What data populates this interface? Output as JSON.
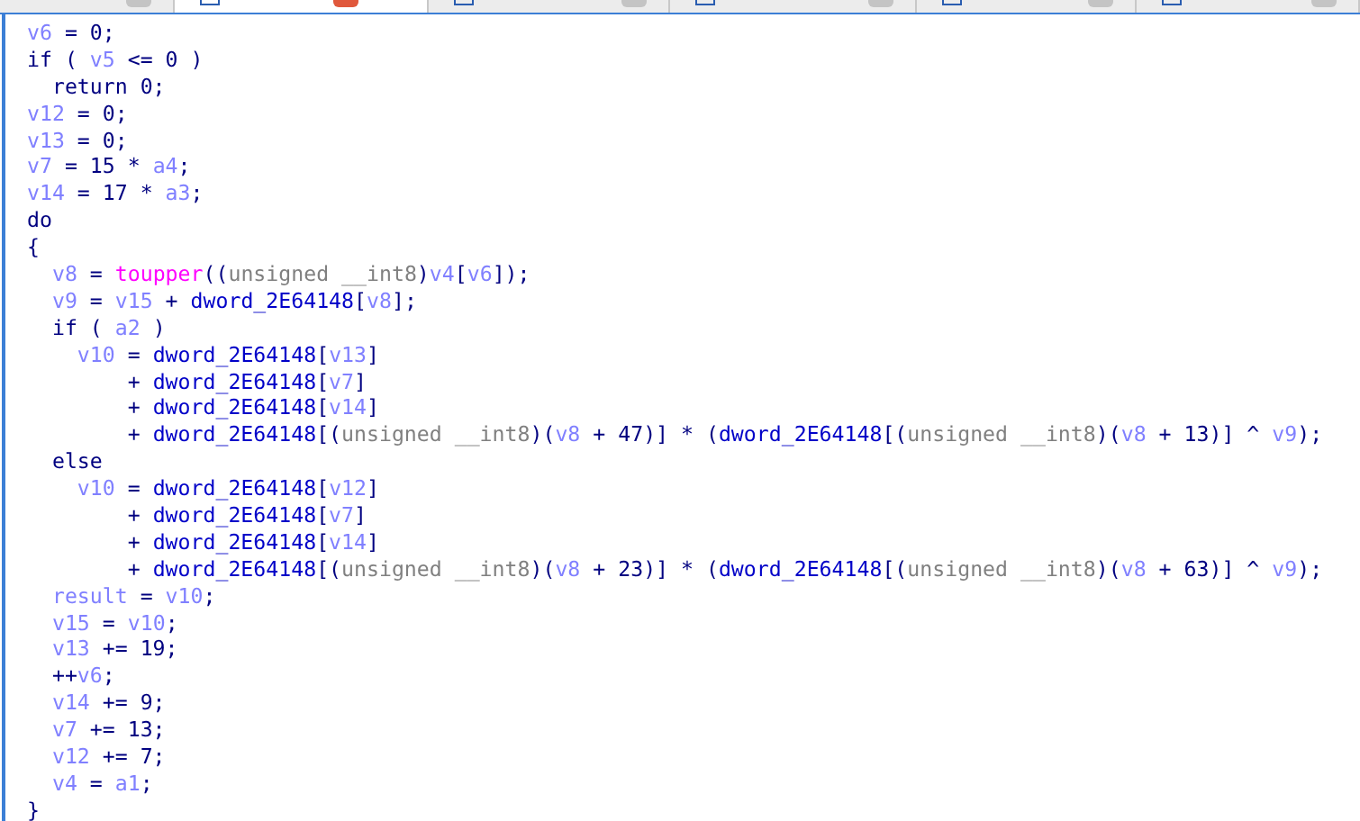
{
  "tabs": [
    {
      "selected": false
    },
    {
      "selected": true
    },
    {
      "selected": false
    },
    {
      "selected": false
    },
    {
      "selected": false
    },
    {
      "selected": false
    }
  ],
  "code_lines": [
    [
      {
        "kind": "var",
        "text": "v6"
      },
      {
        "kind": "plain",
        "text": " = 0;"
      }
    ],
    [
      {
        "kind": "plain",
        "text": "if ( "
      },
      {
        "kind": "var",
        "text": "v5"
      },
      {
        "kind": "plain",
        "text": " <= 0 )"
      }
    ],
    [
      {
        "kind": "plain",
        "text": "  return 0;"
      }
    ],
    [
      {
        "kind": "var",
        "text": "v12"
      },
      {
        "kind": "plain",
        "text": " = 0;"
      }
    ],
    [
      {
        "kind": "var",
        "text": "v13"
      },
      {
        "kind": "plain",
        "text": " = 0;"
      }
    ],
    [
      {
        "kind": "var",
        "text": "v7"
      },
      {
        "kind": "plain",
        "text": " = 15 * "
      },
      {
        "kind": "var",
        "text": "a4"
      },
      {
        "kind": "plain",
        "text": ";"
      }
    ],
    [
      {
        "kind": "var",
        "text": "v14"
      },
      {
        "kind": "plain",
        "text": " = 17 * "
      },
      {
        "kind": "var",
        "text": "a3"
      },
      {
        "kind": "plain",
        "text": ";"
      }
    ],
    [
      {
        "kind": "plain",
        "text": "do"
      }
    ],
    [
      {
        "kind": "plain",
        "text": "{"
      }
    ],
    [
      {
        "kind": "var",
        "text": "  v8"
      },
      {
        "kind": "plain",
        "text": " = "
      },
      {
        "kind": "func",
        "text": "toupper"
      },
      {
        "kind": "plain",
        "text": "(("
      },
      {
        "kind": "type",
        "text": "unsigned __int8"
      },
      {
        "kind": "plain",
        "text": ")"
      },
      {
        "kind": "var",
        "text": "v4"
      },
      {
        "kind": "plain",
        "text": "["
      },
      {
        "kind": "var",
        "text": "v6"
      },
      {
        "kind": "plain",
        "text": "]);"
      }
    ],
    [
      {
        "kind": "var",
        "text": "  v9"
      },
      {
        "kind": "plain",
        "text": " = "
      },
      {
        "kind": "var",
        "text": "v15"
      },
      {
        "kind": "plain",
        "text": " + "
      },
      {
        "kind": "global",
        "text": "dword_2E64148"
      },
      {
        "kind": "plain",
        "text": "["
      },
      {
        "kind": "var",
        "text": "v8"
      },
      {
        "kind": "plain",
        "text": "];"
      }
    ],
    [
      {
        "kind": "plain",
        "text": "  if ( "
      },
      {
        "kind": "var",
        "text": "a2"
      },
      {
        "kind": "plain",
        "text": " )"
      }
    ],
    [
      {
        "kind": "var",
        "text": "    v10"
      },
      {
        "kind": "plain",
        "text": " = "
      },
      {
        "kind": "global",
        "text": "dword_2E64148"
      },
      {
        "kind": "plain",
        "text": "["
      },
      {
        "kind": "var",
        "text": "v13"
      },
      {
        "kind": "plain",
        "text": "]"
      }
    ],
    [
      {
        "kind": "plain",
        "text": "        + "
      },
      {
        "kind": "global",
        "text": "dword_2E64148"
      },
      {
        "kind": "plain",
        "text": "["
      },
      {
        "kind": "var",
        "text": "v7"
      },
      {
        "kind": "plain",
        "text": "]"
      }
    ],
    [
      {
        "kind": "plain",
        "text": "        + "
      },
      {
        "kind": "global",
        "text": "dword_2E64148"
      },
      {
        "kind": "plain",
        "text": "["
      },
      {
        "kind": "var",
        "text": "v14"
      },
      {
        "kind": "plain",
        "text": "]"
      }
    ],
    [
      {
        "kind": "plain",
        "text": "        + "
      },
      {
        "kind": "global",
        "text": "dword_2E64148"
      },
      {
        "kind": "plain",
        "text": "[("
      },
      {
        "kind": "type",
        "text": "unsigned __int8"
      },
      {
        "kind": "plain",
        "text": ")("
      },
      {
        "kind": "var",
        "text": "v8"
      },
      {
        "kind": "plain",
        "text": " + 47)] * ("
      },
      {
        "kind": "global",
        "text": "dword_2E64148"
      },
      {
        "kind": "plain",
        "text": "[("
      },
      {
        "kind": "type",
        "text": "unsigned __int8"
      },
      {
        "kind": "plain",
        "text": ")("
      },
      {
        "kind": "var",
        "text": "v8"
      },
      {
        "kind": "plain",
        "text": " + 13)] ^ "
      },
      {
        "kind": "var",
        "text": "v9"
      },
      {
        "kind": "plain",
        "text": ");"
      }
    ],
    [
      {
        "kind": "plain",
        "text": "  else"
      }
    ],
    [
      {
        "kind": "var",
        "text": "    v10"
      },
      {
        "kind": "plain",
        "text": " = "
      },
      {
        "kind": "global",
        "text": "dword_2E64148"
      },
      {
        "kind": "plain",
        "text": "["
      },
      {
        "kind": "var",
        "text": "v12"
      },
      {
        "kind": "plain",
        "text": "]"
      }
    ],
    [
      {
        "kind": "plain",
        "text": "        + "
      },
      {
        "kind": "global",
        "text": "dword_2E64148"
      },
      {
        "kind": "plain",
        "text": "["
      },
      {
        "kind": "var",
        "text": "v7"
      },
      {
        "kind": "plain",
        "text": "]"
      }
    ],
    [
      {
        "kind": "plain",
        "text": "        + "
      },
      {
        "kind": "global",
        "text": "dword_2E64148"
      },
      {
        "kind": "plain",
        "text": "["
      },
      {
        "kind": "var",
        "text": "v14"
      },
      {
        "kind": "plain",
        "text": "]"
      }
    ],
    [
      {
        "kind": "plain",
        "text": "        + "
      },
      {
        "kind": "global",
        "text": "dword_2E64148"
      },
      {
        "kind": "plain",
        "text": "[("
      },
      {
        "kind": "type",
        "text": "unsigned __int8"
      },
      {
        "kind": "plain",
        "text": ")("
      },
      {
        "kind": "var",
        "text": "v8"
      },
      {
        "kind": "plain",
        "text": " + 23)] * ("
      },
      {
        "kind": "global",
        "text": "dword_2E64148"
      },
      {
        "kind": "plain",
        "text": "[("
      },
      {
        "kind": "type",
        "text": "unsigned __int8"
      },
      {
        "kind": "plain",
        "text": ")("
      },
      {
        "kind": "var",
        "text": "v8"
      },
      {
        "kind": "plain",
        "text": " + 63)] ^ "
      },
      {
        "kind": "var",
        "text": "v9"
      },
      {
        "kind": "plain",
        "text": ");"
      }
    ],
    [
      {
        "kind": "var",
        "text": "  result"
      },
      {
        "kind": "plain",
        "text": " = "
      },
      {
        "kind": "var",
        "text": "v10"
      },
      {
        "kind": "plain",
        "text": ";"
      }
    ],
    [
      {
        "kind": "var",
        "text": "  v15"
      },
      {
        "kind": "plain",
        "text": " = "
      },
      {
        "kind": "var",
        "text": "v10"
      },
      {
        "kind": "plain",
        "text": ";"
      }
    ],
    [
      {
        "kind": "var",
        "text": "  v13"
      },
      {
        "kind": "plain",
        "text": " += 19;"
      }
    ],
    [
      {
        "kind": "plain",
        "text": "  ++"
      },
      {
        "kind": "var",
        "text": "v6"
      },
      {
        "kind": "plain",
        "text": ";"
      }
    ],
    [
      {
        "kind": "var",
        "text": "  v14"
      },
      {
        "kind": "plain",
        "text": " += 9;"
      }
    ],
    [
      {
        "kind": "var",
        "text": "  v7"
      },
      {
        "kind": "plain",
        "text": " += 13;"
      }
    ],
    [
      {
        "kind": "var",
        "text": "  v12"
      },
      {
        "kind": "plain",
        "text": " += 7;"
      }
    ],
    [
      {
        "kind": "var",
        "text": "  v4"
      },
      {
        "kind": "plain",
        "text": " = "
      },
      {
        "kind": "var",
        "text": "a1"
      },
      {
        "kind": "plain",
        "text": ";"
      }
    ],
    [
      {
        "kind": "plain",
        "text": "}"
      }
    ]
  ]
}
